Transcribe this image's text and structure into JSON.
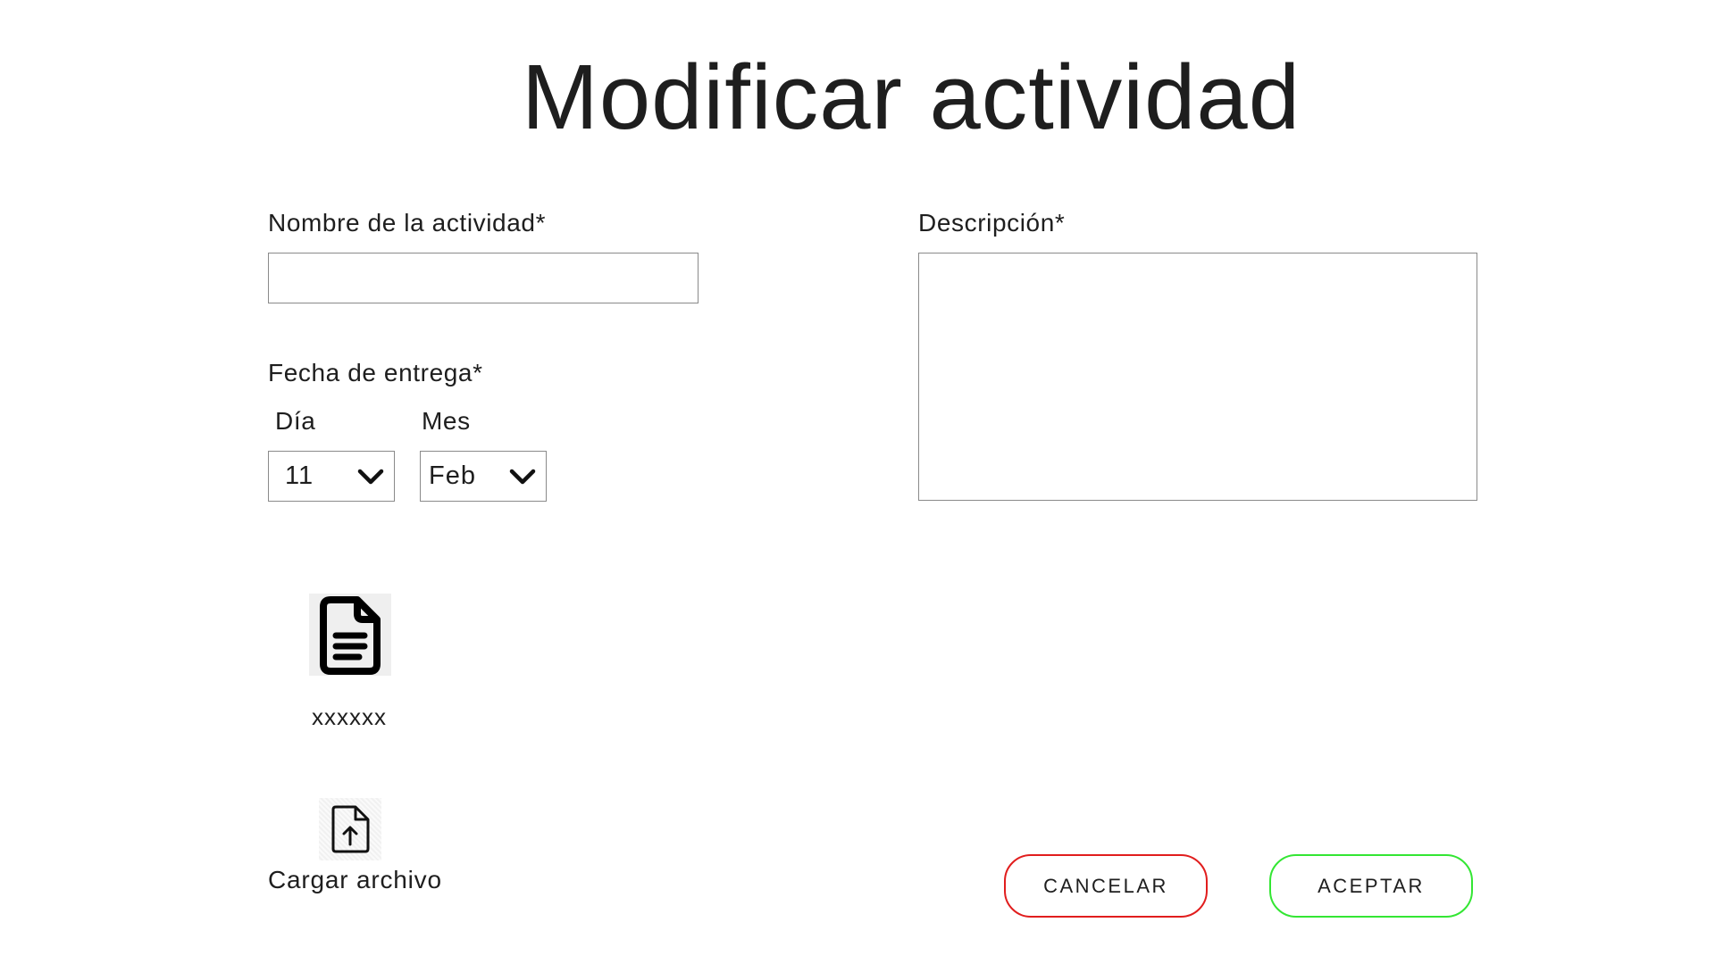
{
  "page": {
    "title": "Modificar actividad"
  },
  "form": {
    "name": {
      "label": "Nombre de la actividad*",
      "value": "",
      "placeholder": ""
    },
    "description": {
      "label": "Descripción*",
      "value": "",
      "placeholder": ""
    },
    "due_date": {
      "label": "Fecha de entrega*",
      "day": {
        "label": "Día",
        "value": "11"
      },
      "month": {
        "label": "Mes",
        "value": "Feb"
      }
    }
  },
  "attachment": {
    "file_name": "xxxxxx",
    "icon": "document-icon",
    "upload_label": "Cargar archivo",
    "upload_icon": "file-upload-icon"
  },
  "actions": {
    "cancel_label": "CANCELAR",
    "accept_label": "ACEPTAR"
  },
  "colors": {
    "cancel_border": "#e11d1d",
    "accept_border": "#33e633",
    "input_border": "#8a8a8a"
  }
}
